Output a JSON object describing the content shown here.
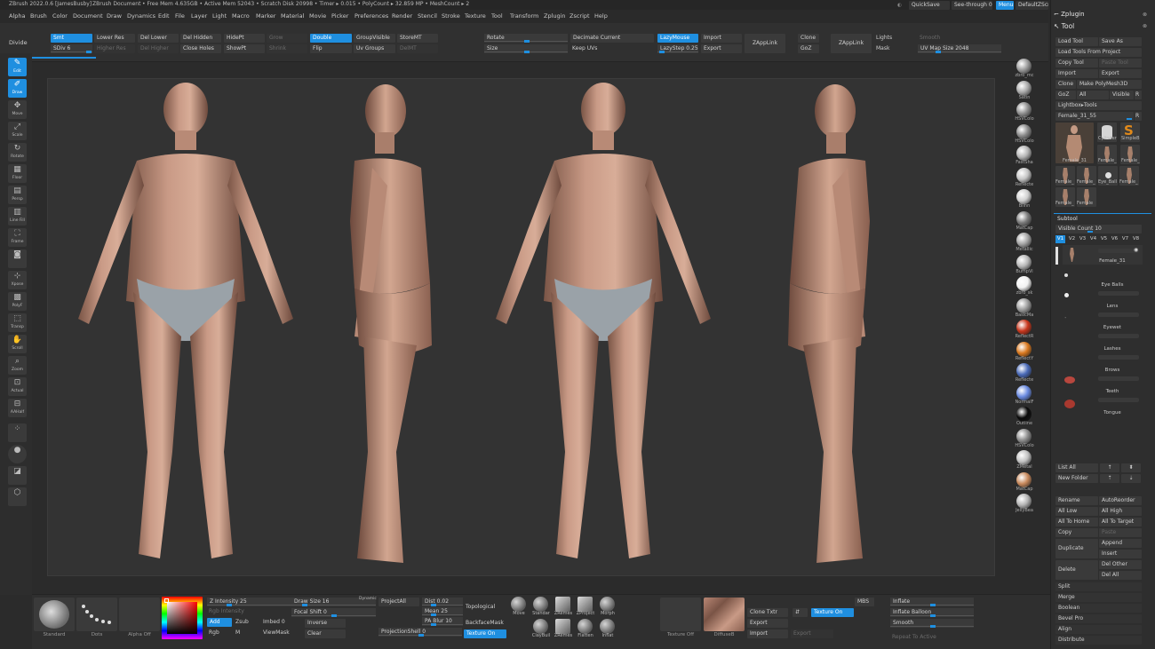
{
  "title_bar": {
    "app": "ZBrush 2022.0.6 [JamesBusby]",
    "document": "ZBrush Document",
    "stats": "• Free Mem 4.635GB • Active Mem 52043 • Scratch Disk 20998 • Timer ▸ 0.015 • PolyCount ▸ 32.859 MP • MeshCount ▸ 2",
    "quicksave": "QuickSave",
    "see_through": "See-through  0",
    "menus_label": "Menus",
    "default_zscript": "DefaultZScript"
  },
  "menu_bar": [
    "Alpha",
    "Brush",
    "Color",
    "Document",
    "Draw",
    "Dynamics",
    "Edit",
    "File",
    "Layer",
    "Light",
    "Macro",
    "Marker",
    "Material",
    "Movie",
    "Picker",
    "Preferences",
    "Render",
    "Stencil",
    "Stroke",
    "Texture",
    "Tool",
    "Transform",
    "Zplugin",
    "Zscript",
    "Help"
  ],
  "top_shelf": {
    "divide": "Divide",
    "smt": "Smt",
    "sdiv": "SDiv 6",
    "lower_res": "Lower Res",
    "higher_res": "Higher Res",
    "del_lower": "Del Lower",
    "del_higher": "Del Higher",
    "del_hidden": "Del Hidden",
    "close_holes": "Close Holes",
    "hidept": "HidePt",
    "showpt": "ShowPt",
    "grow": "Grow",
    "shrink": "Shrink",
    "double": "Double",
    "flip": "Flip",
    "groupvisible": "GroupVisible",
    "uv_groups": "Uv Groups",
    "storemt": "StoreMT",
    "delmt": "DelMT",
    "rotate": "Rotate",
    "size": "Size",
    "decimate_current": "Decimate Current",
    "keep_uvs": "Keep UVs",
    "lazymouse": "LazyMouse",
    "lazystep": "LazyStep 0.25",
    "import": "Import",
    "export": "Export",
    "zapplink1": "ZAppLink",
    "clone": "Clone",
    "goz": "GoZ",
    "zapplink2": "ZAppLink",
    "lights": "Lights",
    "mask": "Mask",
    "smooth": "Smooth",
    "uv_map_size": "UV Map Size 2048"
  },
  "left_tools": [
    {
      "label": "Edit",
      "icon": "edit-icon",
      "on": true
    },
    {
      "label": "Draw",
      "icon": "draw-icon",
      "on": true
    },
    {
      "label": "Move",
      "icon": "move-icon"
    },
    {
      "label": "Scale",
      "icon": "scale-icon"
    },
    {
      "label": "Rotate",
      "icon": "rotate-icon"
    },
    {
      "label": "Floor",
      "icon": "floor-icon"
    },
    {
      "label": "Persp",
      "icon": "persp-icon"
    },
    {
      "label": "Line Fill",
      "icon": "linefill-icon"
    },
    {
      "label": "Frame",
      "icon": "frame-icon"
    },
    {
      "label": "",
      "icon": "camera-icon"
    },
    {
      "label": "Xpose",
      "icon": "xpose-icon"
    },
    {
      "label": "PolyF",
      "icon": "polyframe-icon"
    },
    {
      "label": "Transp",
      "icon": "transp-icon"
    },
    {
      "label": "Scroll",
      "icon": "scroll-icon"
    },
    {
      "label": "Zoom",
      "icon": "zoom-icon"
    },
    {
      "label": "Actual",
      "icon": "actual-icon"
    },
    {
      "label": "AAHalf",
      "icon": "aahalf-icon"
    },
    {
      "label": "",
      "icon": "dynamic-icon"
    },
    {
      "label": "",
      "icon": "solo-icon"
    },
    {
      "label": "",
      "icon": "ghost-icon"
    },
    {
      "label": "",
      "icon": "cube-icon"
    }
  ],
  "materials": [
    {
      "label": "zbro_mc",
      "color": "#9a9a9a"
    },
    {
      "label": "Satin",
      "color": "#a9a9a9"
    },
    {
      "label": "HSVColo",
      "color": "#8f8f8f"
    },
    {
      "label": "HSVColo",
      "color": "#8a8a8a"
    },
    {
      "label": "FastSha",
      "color": "#b5b5b5"
    },
    {
      "label": "Reflecte",
      "color": "#c4c4c4"
    },
    {
      "label": "Blinn",
      "color": "#d0d0d0"
    },
    {
      "label": "MatCap",
      "color": "#7a7a7a"
    },
    {
      "label": "Metallic",
      "color": "#a5a5a5"
    },
    {
      "label": "BumpVi",
      "color": "#b8b8b8"
    },
    {
      "label": "zbro_sk",
      "color": "#f2f2f2"
    },
    {
      "label": "BasicMa",
      "color": "#9c9c9c"
    },
    {
      "label": "ReflectR",
      "color": "#c8361c"
    },
    {
      "label": "ReflectY",
      "color": "#d9781e"
    },
    {
      "label": "Reflecte",
      "color": "#4a6ab8"
    },
    {
      "label": "NormalF",
      "color": "#6a8ae0"
    },
    {
      "label": "Outline",
      "color": "#0a0a0a"
    },
    {
      "label": "HSVColo",
      "color": "#8d8d8d"
    },
    {
      "label": "ZMetal",
      "color": "#c2c2c2"
    },
    {
      "label": "MatCap",
      "color": "#c8895c"
    },
    {
      "label": "JellyBea",
      "color": "#b4b4b4"
    }
  ],
  "right_panel": {
    "zplugin": "Zplugin",
    "tool": "Tool",
    "load_tool": "Load Tool",
    "save_as": "Save As",
    "load_tools_from_project": "Load Tools From Project",
    "copy_tool": "Copy Tool",
    "paste_tool": "Paste Tool",
    "import": "Import",
    "export": "Export",
    "clone": "Clone",
    "make_polymesh": "Make PolyMesh3D",
    "goz": "GoZ",
    "all": "All",
    "visible": "Visible",
    "r": "R",
    "lightbox_tools": "Lightbox▸Tools",
    "current_tool": "Female_31_55",
    "current_tool_value": "R",
    "tool_thumbs": [
      {
        "label": "Female_31",
        "color": "#b48a73"
      },
      {
        "label": "Cylinder",
        "color": "#c9c9c9"
      },
      {
        "label": "SimpleB",
        "color": "#e28a1a"
      },
      {
        "label": "Female_",
        "color": "#a7806b"
      },
      {
        "label": "Female_",
        "color": "#a7806b"
      },
      {
        "label": "Female_",
        "color": "#a7806b"
      },
      {
        "label": "Female_",
        "color": "#a7806b"
      },
      {
        "label": "Eye_Ball",
        "color": "#d8d8d8"
      },
      {
        "label": "Female_",
        "color": "#a7806b"
      },
      {
        "label": "Female_",
        "color": "#a7806b"
      },
      {
        "label": "Female",
        "color": "#a7806b"
      }
    ],
    "subtool": "Subtool",
    "visible_count": "Visible Count 10",
    "versions": [
      "V1",
      "V2",
      "V3",
      "V4",
      "V5",
      "V6",
      "V7",
      "V8"
    ],
    "subtools": [
      "Female_31",
      "Eye Balls",
      "Lens",
      "Eyewet",
      "Lashes",
      "Brows",
      "Teeth",
      "Tongue"
    ],
    "list_all": "List All",
    "new_folder": "New Folder",
    "rename": "Rename",
    "autoreorder": "AutoReorder",
    "all_low": "All Low",
    "all_high": "All High",
    "all_to_home": "All To Home",
    "all_to_target": "All To Target",
    "copy": "Copy",
    "paste": "Paste",
    "duplicate": "Duplicate",
    "append": "Append",
    "insert": "Insert",
    "delete": "Delete",
    "del_other": "Del Other",
    "del_all": "Del All",
    "split": "Split",
    "merge": "Merge",
    "boolean": "Boolean",
    "bevel_pro": "Bevel Pro",
    "align": "Align",
    "distribute": "Distribute"
  },
  "bottom_shelf": {
    "standard": "Standard",
    "dots": "Dots",
    "alpha_off": "Alpha Off",
    "z_intensity": "Z Intensity 25",
    "rgb_intensity": "Rgb Intensity",
    "add": "Add",
    "zsub": "Zsub",
    "rgb": "Rgb",
    "m": "M",
    "draw_size": "Draw Size 16",
    "dynamic": "Dynamic",
    "focal_shift": "Focal Shift 0",
    "imbed": "Imbed 0",
    "viewmask": "ViewMask",
    "inverse": "Inverse",
    "clear": "Clear",
    "projectall": "ProjectAll",
    "projectionshell": "ProjectionShell 0",
    "dist": "Dist 0.02",
    "mean": "Mean 25",
    "pa_blur": "PA Blur 10",
    "topological": "Topological",
    "backfacemask": "BackfaceMask",
    "texture_on": "Texture On",
    "brushes": [
      "Move",
      "Standar",
      "ZRemes",
      "ZProject",
      "Morph",
      "ClayBuil",
      "ZRemes",
      "Flatten",
      "Inflat"
    ],
    "texture_off": "Texture Off",
    "diffuse": "DiffuseB",
    "clone_txtr": "Clone Txtr",
    "export": "Export",
    "import": "Import",
    "texture_on2": "Texture On",
    "export2": "Export",
    "mbs": "MBS",
    "inflate": "Inflate",
    "inflate_balloon": "Inflate Balloon",
    "smooth": "Smooth",
    "repeat_to_active": "Repeat To Active"
  },
  "canvas": {
    "background": "#333333"
  },
  "accent": "#1f8fe0"
}
